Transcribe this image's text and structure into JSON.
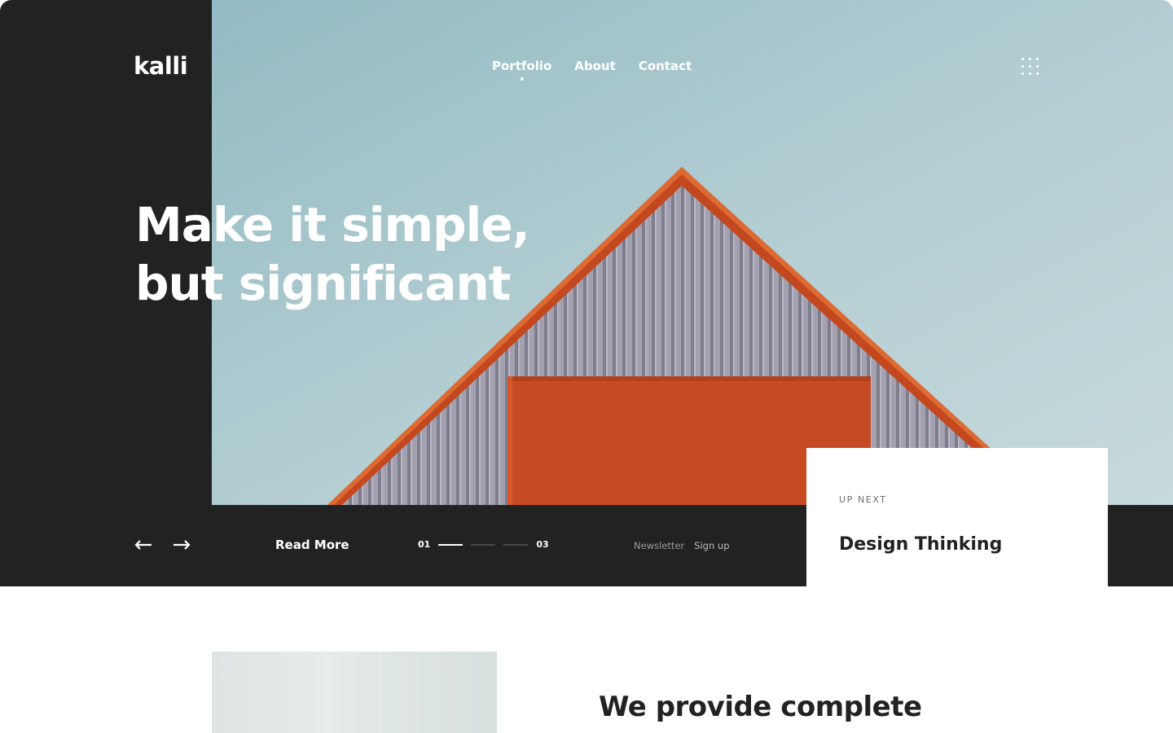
{
  "brand": {
    "logo": "kalli"
  },
  "nav": {
    "items": [
      {
        "label": "Portfolio",
        "active": true
      },
      {
        "label": "About",
        "active": false
      },
      {
        "label": "Contact",
        "active": false
      }
    ],
    "menu_icon": "grid-dots-icon"
  },
  "hero": {
    "headline_line1": "Make it simple,",
    "headline_line2": "but significant",
    "read_more": "Read More",
    "pager": {
      "current": "01",
      "total": "03",
      "active_index": 0
    },
    "newsletter_label": "Newsletter",
    "signup_label": "Sign up",
    "prev_icon": "arrow-left-icon",
    "next_icon": "arrow-right-icon"
  },
  "up_next": {
    "kicker": "UP NEXT",
    "title": "Design Thinking"
  },
  "section": {
    "heading": "We provide complete"
  },
  "colors": {
    "dark": "#222222",
    "sky": "#a9c7cd",
    "roof_orange": "#c94a23",
    "wall_grey": "#9a98a6",
    "white": "#ffffff"
  }
}
